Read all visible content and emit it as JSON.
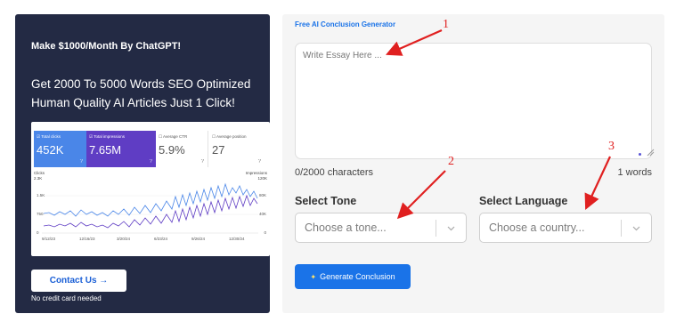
{
  "ad": {
    "eyebrow": "Make $1000/Month By ChatGPT!",
    "headline": "Get 2000 To 5000 Words SEO Optimized Human Quality AI Articles Just 1 Click!",
    "dashboard": {
      "kpis": [
        {
          "label": "☑ Total clicks",
          "value": "452K"
        },
        {
          "label": "☑ Total impressions",
          "value": "7.65M"
        },
        {
          "label": "☐ Average CTR",
          "value": "5.9%"
        },
        {
          "label": "☐ Average position",
          "value": "27"
        }
      ],
      "left_axis_title": "Clicks",
      "left_axis_max": "2.3K",
      "right_axis_title": "Impressions",
      "right_axis_max": "120K",
      "left_ticks": [
        "1.5K",
        "750",
        "0"
      ],
      "right_ticks": [
        "80K",
        "40K",
        "0"
      ],
      "dates": [
        "9/12/23",
        "12/16/23",
        "3/20/24",
        "6/23/24",
        "9/26/24",
        "12/30/24"
      ]
    },
    "contact_label": "Contact Us →",
    "note": "No credit card needed"
  },
  "form": {
    "title": "Free AI Conclusion Generator",
    "essay_placeholder": "Write Essay Here ...",
    "char_count": "0/2000 characters",
    "word_count": "1 words",
    "tone_label": "Select Tone",
    "tone_placeholder": "Choose a tone...",
    "language_label": "Select Language",
    "language_placeholder": "Choose a country...",
    "generate_label": "Generate Conclusion",
    "generate_icon": "sparkle-icon"
  },
  "annotations": {
    "marker_1": "1",
    "marker_2": "2",
    "marker_3": "3",
    "color": "#e02020"
  },
  "colors": {
    "ad_bg": "#232a44",
    "accent": "#1a73e8",
    "clicks": "#4a86e8",
    "impressions": "#5f3dc4"
  }
}
